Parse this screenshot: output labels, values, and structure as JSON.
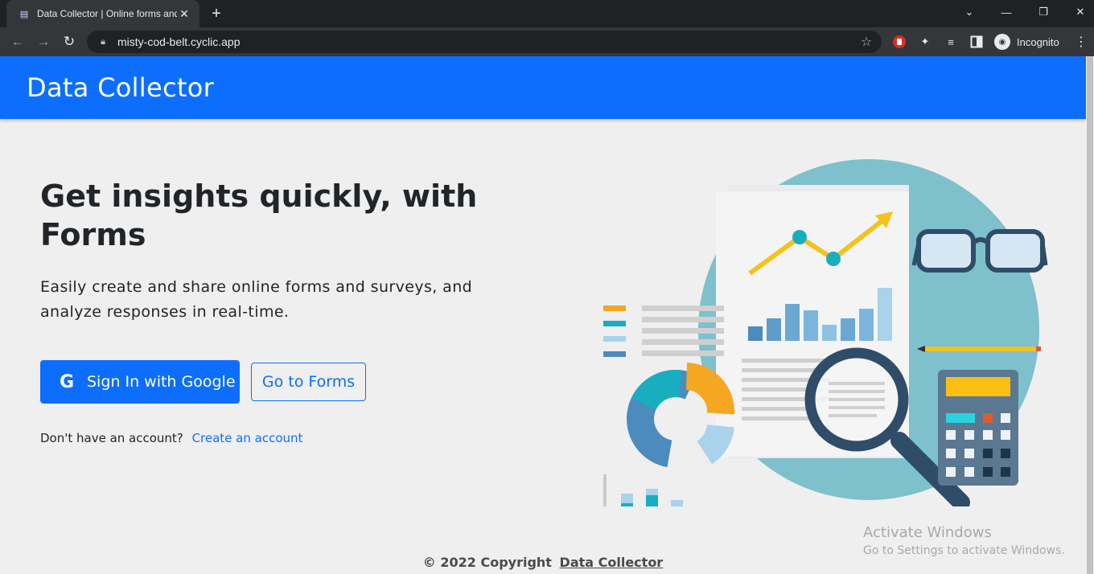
{
  "browser": {
    "tab_title": "Data Collector | Online forms and",
    "url": "misty-cod-belt.cyclic.app",
    "profile_label": "Incognito"
  },
  "header": {
    "brand": "Data Collector"
  },
  "hero": {
    "headline": "Get insights quickly, with Forms",
    "lead": "Easily create and share online forms and surveys, and analyze responses in real-time.",
    "google_button": "Sign In with Google",
    "forms_button": "Go to Forms",
    "signup_prompt": "Don't have an account?",
    "signup_link": "Create an account"
  },
  "footer": {
    "copyright": "© 2022 Copyright",
    "brand_link": "Data Collector"
  },
  "watermark": {
    "line1": "Activate Windows",
    "line2": "Go to Settings to activate Windows."
  },
  "colors": {
    "primary": "#0d6efd",
    "page_bg": "#efefef",
    "chrome_dark": "#202124",
    "chrome_mid": "#35363a"
  }
}
